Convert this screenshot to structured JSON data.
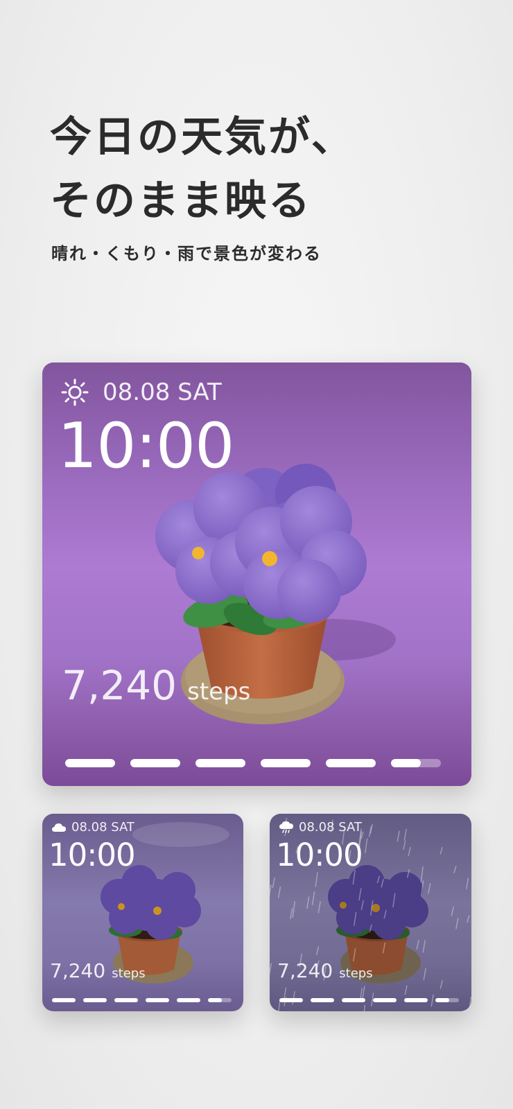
{
  "headline": {
    "line1": "今日の天気が、",
    "line2": "そのまま映る"
  },
  "subheadline": "晴れ・くもり・雨で景色が変わる",
  "widgets": {
    "sunny": {
      "weather_icon": "sun-icon",
      "date": "08.08 SAT",
      "time": "10:00",
      "steps_value": "7,240",
      "steps_unit": "steps",
      "progress_segments": [
        1,
        1,
        1,
        1,
        1,
        0.6
      ]
    },
    "cloudy": {
      "weather_icon": "cloud-icon",
      "date": "08.08 SAT",
      "time": "10:00",
      "steps_value": "7,240",
      "steps_unit": "steps",
      "progress_segments": [
        1,
        1,
        1,
        1,
        1,
        0.6
      ]
    },
    "rainy": {
      "weather_icon": "rain-cloud-icon",
      "date": "08.08 SAT",
      "time": "10:00",
      "steps_value": "7,240",
      "steps_unit": "steps",
      "progress_segments": [
        1,
        1,
        1,
        1,
        1,
        0.6
      ]
    }
  },
  "colors": {
    "text_dark": "#2b2b2b",
    "flower_petal": "#8f70cf",
    "flower_center": "#f2b52f",
    "leaf": "#3f8f45",
    "pot": "#c06b42",
    "saucer": "#a8916e"
  }
}
